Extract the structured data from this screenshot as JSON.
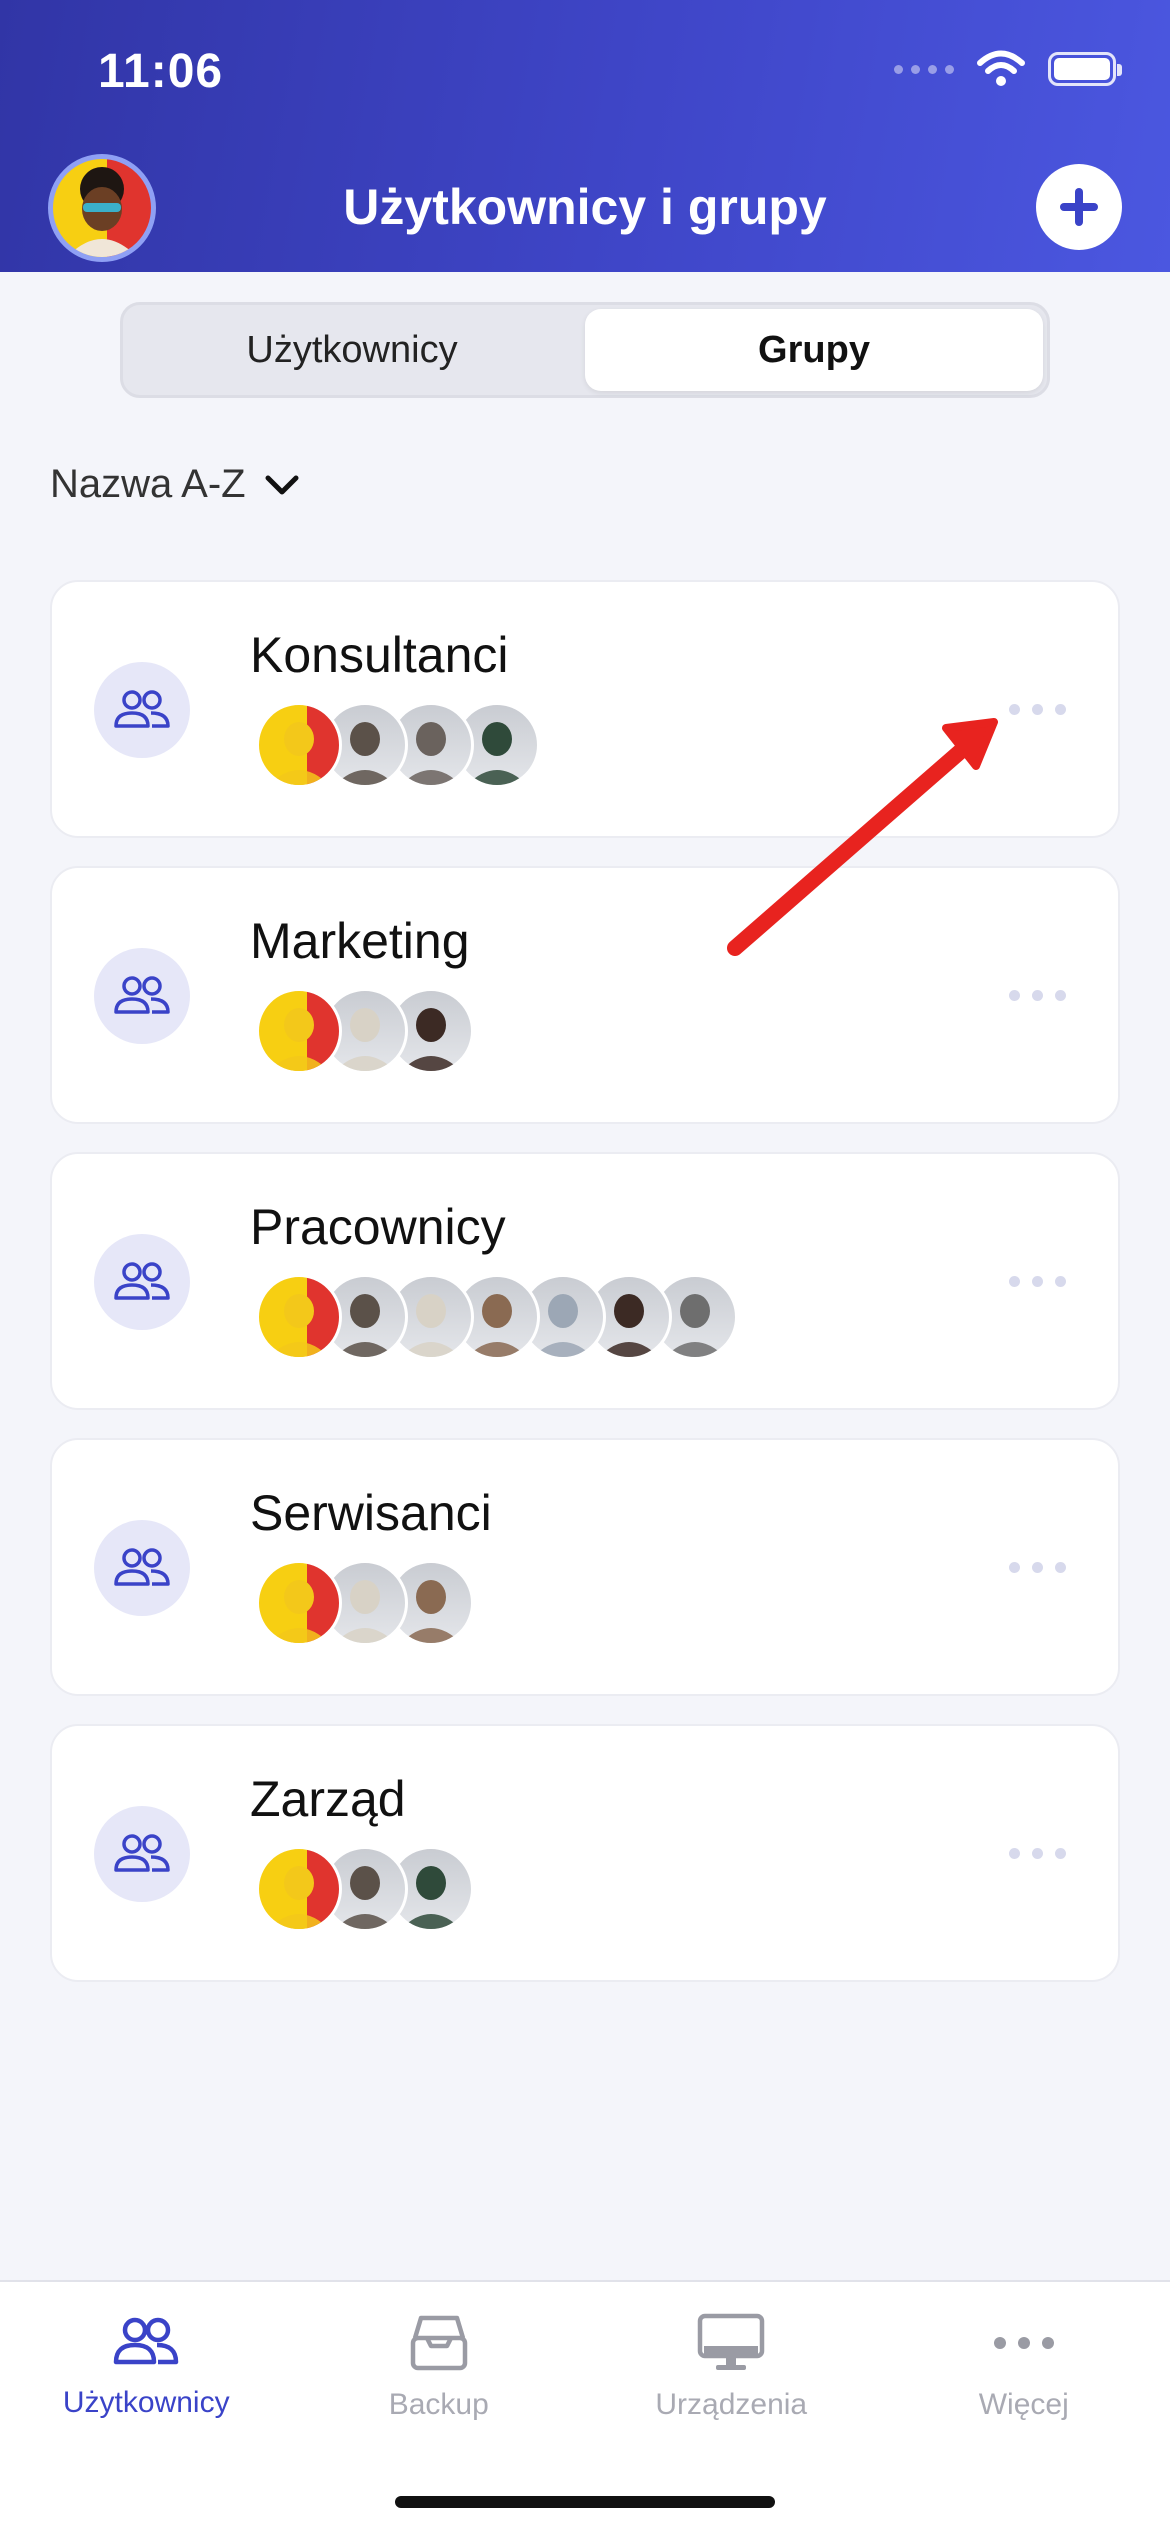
{
  "status_bar": {
    "time": "11:06"
  },
  "header": {
    "title": "Użytkownicy i grupy",
    "add_icon": "plus-icon"
  },
  "segmented": {
    "tab_users": "Użytkownicy",
    "tab_groups": "Grupy",
    "selected": "Grupy"
  },
  "sort": {
    "label": "Nazwa A-Z",
    "icon": "chevron-down-icon"
  },
  "groups": [
    {
      "name": "Konsultanci",
      "member_count": 4,
      "avatar_colors": [
        "#F3C81A",
        "#5B5149",
        "#6A625D",
        "#2F4A3A"
      ]
    },
    {
      "name": "Marketing",
      "member_count": 3,
      "avatar_colors": [
        "#F3C81A",
        "#D8D2C6",
        "#3C2A24"
      ]
    },
    {
      "name": "Pracownicy",
      "member_count": 7,
      "avatar_colors": [
        "#F3C81A",
        "#5B5149",
        "#D8D2C6",
        "#8A6A52",
        "#9CA7B5",
        "#3C2A24",
        "#6E6E6E"
      ]
    },
    {
      "name": "Serwisanci",
      "member_count": 3,
      "avatar_colors": [
        "#F3C81A",
        "#D8D2C6",
        "#8A6A52"
      ]
    },
    {
      "name": "Zarząd",
      "member_count": 3,
      "avatar_colors": [
        "#F3C81A",
        "#5B5149",
        "#2F4A3A"
      ]
    }
  ],
  "tabbar": {
    "tabs": [
      {
        "label": "Użytkownicy",
        "icon": "users-icon",
        "active": true
      },
      {
        "label": "Backup",
        "icon": "archive-box-icon",
        "active": false
      },
      {
        "label": "Urządzenia",
        "icon": "monitor-icon",
        "active": false
      },
      {
        "label": "Więcej",
        "icon": "more-dots-icon",
        "active": false
      }
    ]
  },
  "colors": {
    "accent": "#3A43C8",
    "header_start": "#3135A6",
    "header_end": "#4B57E0",
    "annotation_arrow": "#E8231F"
  }
}
